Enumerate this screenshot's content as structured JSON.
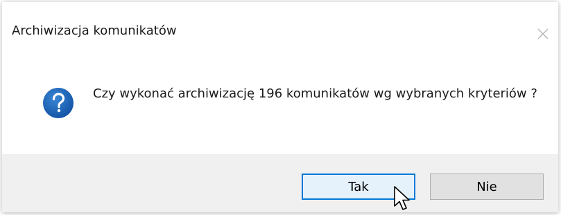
{
  "dialog": {
    "title": "Archiwizacja komunikatów",
    "message": "Czy wykonać archiwizację 196 komunikatów wg wybranych kryteriów ?",
    "icon": "question-icon",
    "buttons": {
      "yes_label": "Tak",
      "no_label": "Nie"
    }
  },
  "colors": {
    "icon_blue": "#1f66b5",
    "focus_border": "#0078d7",
    "footer_bg": "#f0f0f0"
  }
}
